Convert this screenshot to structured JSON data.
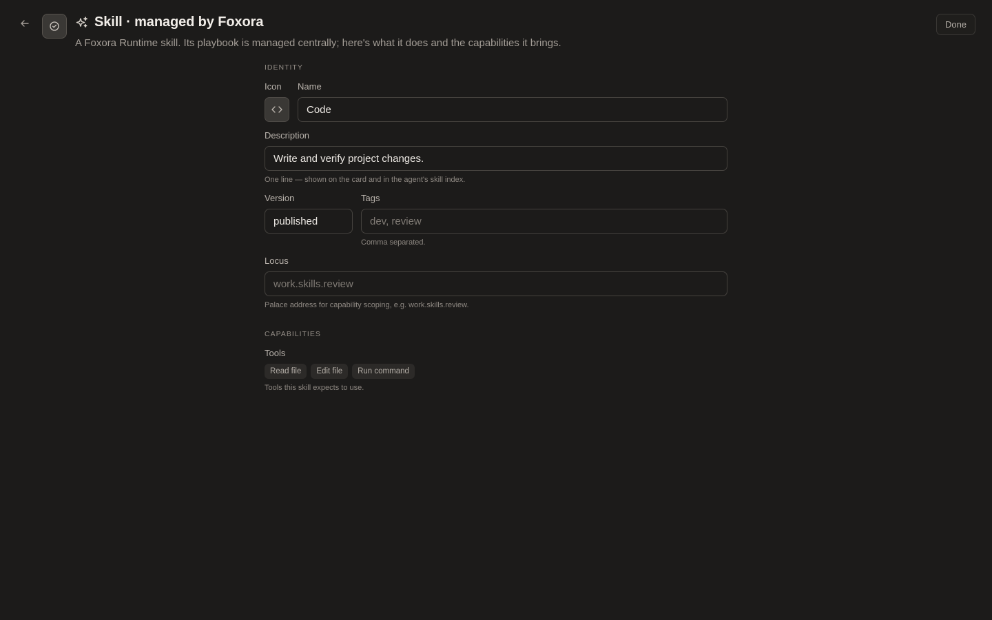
{
  "header": {
    "title": "Skill · managed by Foxora",
    "subtitle": "A Foxora Runtime skill. Its playbook is managed centrally; here's what it does and the capabilities it brings.",
    "done_label": "Done"
  },
  "identity": {
    "section_label": "IDENTITY",
    "icon_label": "Icon",
    "icon_name": "code-icon",
    "name_label": "Name",
    "name_value": "Code",
    "description_label": "Description",
    "description_value": "Write and verify project changes.",
    "description_hint": "One line — shown on the card and in the agent's skill index.",
    "version_label": "Version",
    "version_value": "published",
    "tags_label": "Tags",
    "tags_placeholder": "dev, review",
    "tags_hint": "Comma separated.",
    "locus_label": "Locus",
    "locus_placeholder": "work.skills.review",
    "locus_hint": "Palace address for capability scoping, e.g. work.skills.review."
  },
  "capabilities": {
    "section_label": "CAPABILITIES",
    "tools_label": "Tools",
    "tools": [
      "Read file",
      "Edit file",
      "Run command"
    ],
    "tools_hint": "Tools this skill expects to use."
  },
  "colors": {
    "background": "#1c1b1a",
    "border": "#45423e",
    "text": "#e8e4df",
    "muted": "#a39d96"
  }
}
